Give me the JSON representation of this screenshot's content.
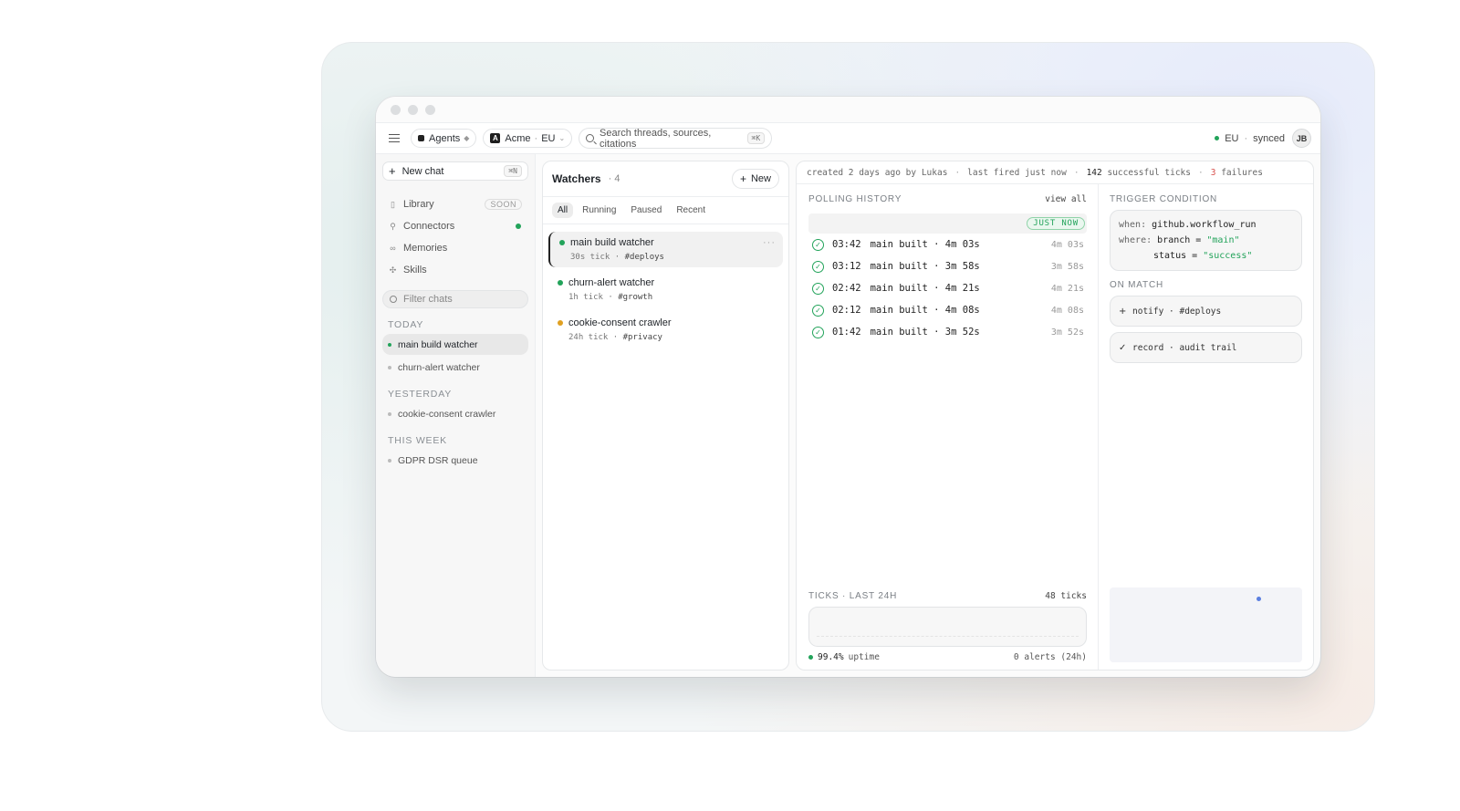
{
  "toolbar": {
    "workspace_label": "Agents",
    "org_name": "Acme",
    "org_region": "EU",
    "org_logo_letter": "A",
    "search_placeholder": "Search threads, sources, citations",
    "search_shortcut": "⌘K",
    "region": "EU",
    "sync_status": "synced",
    "avatar_initials": "JB"
  },
  "sidebar": {
    "new_chat_label": "New chat",
    "new_chat_shortcut": "⌘N",
    "nav": [
      {
        "label": "Library",
        "badge": "SOON",
        "icon": "book-icon"
      },
      {
        "label": "Connectors",
        "icon": "plug-icon",
        "status": "online"
      },
      {
        "label": "Memories",
        "icon": "memory-icon"
      },
      {
        "label": "Skills",
        "icon": "sparkle-icon"
      }
    ],
    "filter_placeholder": "Filter chats",
    "groups": [
      {
        "label": "TODAY",
        "items": [
          "main build watcher",
          "churn-alert watcher"
        ]
      },
      {
        "label": "YESTERDAY",
        "items": [
          "cookie-consent crawler"
        ]
      },
      {
        "label": "THIS WEEK",
        "items": [
          "GDPR DSR queue"
        ]
      }
    ]
  },
  "watchers": {
    "title": "Watchers",
    "count": "4",
    "new_label": "New",
    "tabs": [
      "All",
      "Running",
      "Paused",
      "Recent"
    ],
    "items": [
      {
        "name": "main build watcher",
        "tick": "30s tick",
        "channel": "#deploys",
        "status_color": "#22a35a"
      },
      {
        "name": "churn-alert watcher",
        "tick": "1h tick",
        "channel": "#growth",
        "status_color": "#22a35a"
      },
      {
        "name": "cookie-consent crawler",
        "tick": "24h tick",
        "channel": "#privacy",
        "status_color": "#e0a021"
      }
    ]
  },
  "detail": {
    "created": "created 2 days ago by Lukas",
    "last_fired": "last fired just now",
    "successful_count": "142",
    "successful_label": "successful ticks",
    "failures_count": "3",
    "failures_label": "failures",
    "history_title": "POLLING HISTORY",
    "view_all": "view all",
    "just_now": "JUST NOW",
    "history": [
      {
        "time": "03:42",
        "text": "main built · 4m 03s",
        "duration": "4m 03s"
      },
      {
        "time": "03:12",
        "text": "main built · 3m 58s",
        "duration": "3m 58s"
      },
      {
        "time": "02:42",
        "text": "main built · 4m 21s",
        "duration": "4m 21s"
      },
      {
        "time": "02:12",
        "text": "main built · 4m 08s",
        "duration": "4m 08s"
      },
      {
        "time": "01:42",
        "text": "main built · 3m 52s",
        "duration": "3m 52s"
      }
    ],
    "ticks_title": "TICKS · LAST 24H",
    "ticks_count": "48 ticks",
    "uptime_value": "99.4%",
    "uptime_label": "uptime",
    "alerts": "0 alerts (24h)",
    "trigger_title": "TRIGGER CONDITION",
    "trigger": {
      "when_key": "when:",
      "when_val": "github.workflow_run",
      "where_key": "where:",
      "branch_key": "branch =",
      "branch_val": "\"main\"",
      "status_key": "status =",
      "status_val": "\"success\""
    },
    "on_match_title": "ON MATCH",
    "on_match": [
      {
        "icon": "plus-icon",
        "glyph": "+",
        "text": "notify · #deploys"
      },
      {
        "icon": "check-icon",
        "glyph": "✓",
        "text": "record · audit trail"
      }
    ]
  },
  "colors": {
    "accent_green": "#22a35a",
    "failure_red": "#d9534f",
    "warning_amber": "#e0a021"
  }
}
